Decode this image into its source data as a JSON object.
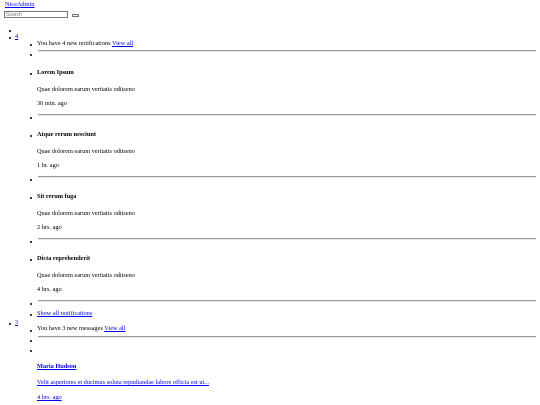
{
  "brand": {
    "name": "NiceAdmin"
  },
  "search": {
    "placeholder": "Search"
  },
  "notifications": {
    "count": "4",
    "header_text": "You have 4 new notifications ",
    "view_all_label": "View all",
    "items": [
      {
        "title": "Lorem Ipsum",
        "text": "Quae dolorem earum veritatis oditseno",
        "time": "30 min. ago"
      },
      {
        "title": "Atque rerum nesciunt",
        "text": "Quae dolorem earum veritatis oditseno",
        "time": "1 hr. ago"
      },
      {
        "title": "Sit rerum fuga",
        "text": "Quae dolorem earum veritatis oditseno",
        "time": "2 hrs. ago"
      },
      {
        "title": "Dicta reprehenderit",
        "text": "Quae dolorem earum veritatis oditseno",
        "time": "4 hrs. ago"
      }
    ],
    "show_all_label": "Show all notifications"
  },
  "messages": {
    "count": "3",
    "header_text": "You have 3 new messages ",
    "view_all_label": "View all",
    "items": [
      {
        "name": "Maria Hudson",
        "text": "Velit asperiores et ducimus soluta repudiandae labore officia est ut...",
        "time": "4 hrs. ago"
      }
    ]
  }
}
